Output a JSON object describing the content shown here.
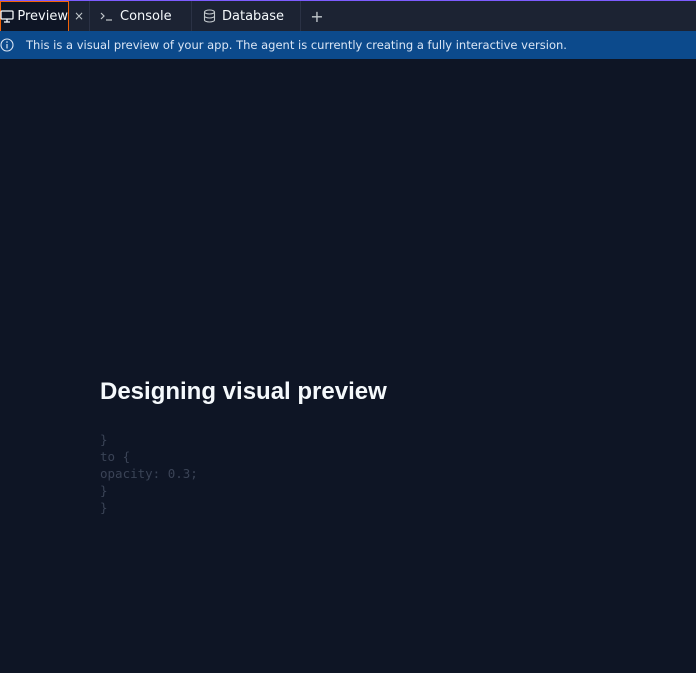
{
  "tabs": {
    "preview_label": "Preview",
    "close_glyph": "×",
    "console_label": "Console",
    "database_label": "Database",
    "add_glyph": "+"
  },
  "banner": {
    "text": "This is a visual preview of your app. The agent is currently creating a fully interactive version."
  },
  "main": {
    "heading": "Designing visual preview",
    "code_lines": [
      "}",
      "to {",
      "opacity: 0.3;",
      "}",
      "}"
    ]
  },
  "colors": {
    "background": "#0e1525",
    "tabbar": "#1c2333",
    "active_tab_border": "#f26207",
    "banner": "#0c4a8c",
    "accent_line": "#7c5cff"
  },
  "icons": {
    "preview": "monitor-icon",
    "console": "terminal-icon",
    "database": "database-icon",
    "banner": "info-icon"
  }
}
